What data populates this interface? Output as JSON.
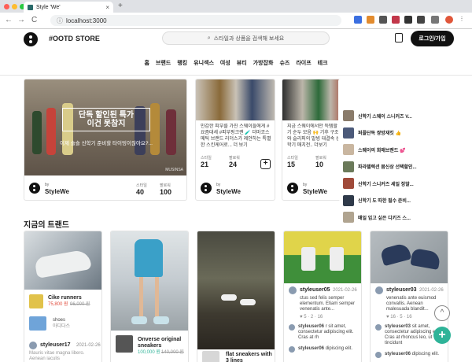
{
  "browser": {
    "tab_title": "Style 'We'",
    "tab_close": "×",
    "new_tab": "+",
    "url": "localhost:3000",
    "nav_back": "←",
    "nav_forward": "→",
    "nav_reload": "C"
  },
  "header": {
    "nav": [
      "#OOTD",
      "STORE"
    ],
    "search_placeholder": "스타일과 상품을 검색해 보세요",
    "login": "로그인/가입"
  },
  "categories": [
    "홈",
    "브랜드",
    "랭킹",
    "유니섹스",
    "여성",
    "뷰티",
    "가방잡화",
    "슈즈",
    "라이프",
    "테크"
  ],
  "hero": {
    "title_line1": "단독 할인된 특가",
    "title_line2": "이건 못참지",
    "subtitle": "이제 슬슬 신학기 준비할 타이밍이잖아요?...",
    "watermark": "MUSINSA",
    "by": "by",
    "author": "StyleWe",
    "stats": [
      {
        "label": "스타일",
        "value": "40"
      },
      {
        "label": "팔로워",
        "value": "100"
      }
    ]
  },
  "cards": [
    {
      "desc": "민감한 피부를 가진 스웨이들에게 #요즘대세 #피부핑크랜 🧪 더마코스메틱 브랜드 리더스가 제안하는 특별한 스킨케어로... 더 보기",
      "by": "by",
      "author": "StyleWe",
      "stats": [
        {
          "label": "스타일",
          "value": "21"
        },
        {
          "label": "팔로워",
          "value": "24"
        }
      ],
      "plus": "+"
    },
    {
      "desc": "지금 스웨이에서만 득템할 수 있는 인기 순두 모음 🙌 기후 구조이 포커즈와 슬리퍼의 발빙 대결속 상품들을 신학기 매치전.. 더보기",
      "by": "by",
      "author": "StyleWe",
      "stats": [
        {
          "label": "스타일",
          "value": "15"
        },
        {
          "label": "팔로워",
          "value": "10"
        }
      ],
      "plus": "+"
    }
  ],
  "side_list": [
    {
      "text": "신학기 스웨이 스니커즈 V...",
      "color": "#8a7b6a"
    },
    {
      "text": "퍼플단독 쌍방재킷 👍",
      "color": "#4c5a7a"
    },
    {
      "text": "스웨이의 희애브랜드 💕",
      "color": "#c9b6a0"
    },
    {
      "text": "파라텔렉션 봄신상 선택할인...",
      "color": "#6b7a5a"
    },
    {
      "text": "신학기 스니커즈 세일 정말...",
      "color": "#a04a3a"
    },
    {
      "text": "신학기 도 따한 필수 준비...",
      "color": "#2f3a4a"
    },
    {
      "text": "매일 입고 싶은 디키즈 스...",
      "color": "#b0a490"
    }
  ],
  "trend": {
    "title": "지금의 트랜드",
    "col1": {
      "product1_name": "Cike runners",
      "product1_price": "75,800 원",
      "product1_old": "96,000 원",
      "product2_name": "shoes",
      "product2_brand": "아디다스",
      "user": "styleuser17",
      "date": "2021-02-26",
      "text": "Mauris vitae magna libero. Aenean iaculis"
    },
    "col2": {
      "product_name": "Onverse original sneakers",
      "price": "100,000 원",
      "old": "140,000 원"
    },
    "col3": {
      "product_name": "flat sneakers with 3 lines"
    },
    "col4": {
      "user": "styleuser05",
      "date": "2021-02-26",
      "text": "ctus sed felis semper elementum. Etiam semper venenatis ante...",
      "counts": "♥ 5 · 2 · 16",
      "comment1_user": "styleuser06",
      "comment1_text": "r sit amet, consectetur adipiscing elit. Cras at rh",
      "comment2_user": "styleuser06",
      "comment2_text": "dipiscing elit."
    },
    "col5": {
      "user": "styleuser03",
      "date": "2021-02-26",
      "text": "venenatis ante euismod convallis. Aenean malesuada blandit...",
      "counts": "♥ 16 · 5 · 16",
      "comment1_user": "styleuser03",
      "comment1_text": "sit amet, consectetur adipiscing elit. Cras at rhoncus leo, ut tincidunt",
      "comment2_user": "styleuser06",
      "comment2_text": "dipiscing elit."
    }
  },
  "fab_up": "^",
  "fab_plus": "+",
  "colors": {
    "accent": "#111111",
    "fab_green": "#2eb398",
    "price_red": "#e14b3b"
  }
}
